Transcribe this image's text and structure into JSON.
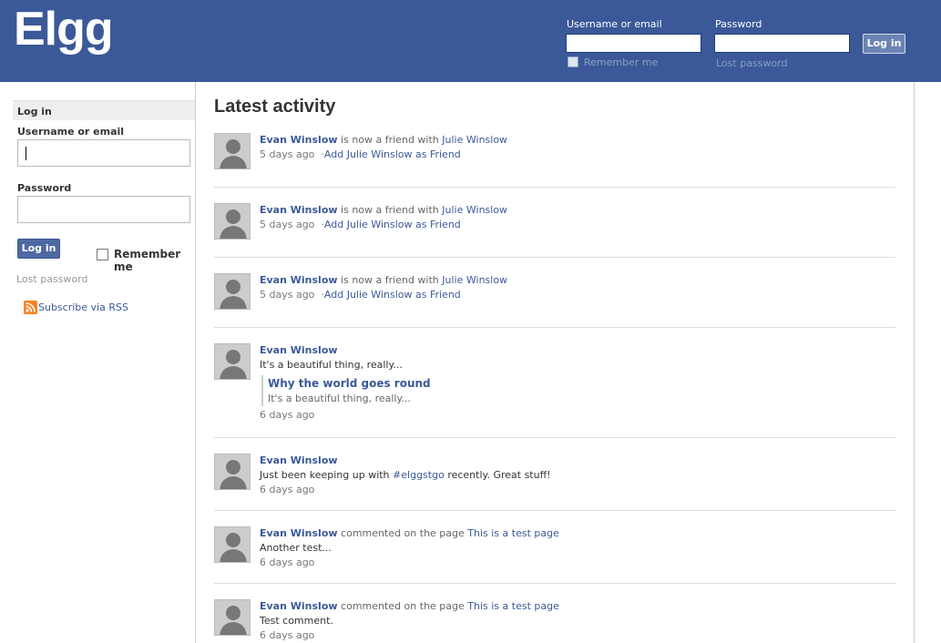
{
  "header": {
    "logo": "Elgg",
    "username_label": "Username or email",
    "password_label": "Password",
    "login_button": "Log in",
    "remember_label": "Remember me",
    "lost_password": "Lost password"
  },
  "sidebar": {
    "title": "Log in",
    "username_label": "Username or email",
    "password_label": "Password",
    "login_button": "Log in",
    "remember_label": "Remember me",
    "lost_password": "Lost password",
    "rss_link": "Subscribe via RSS"
  },
  "main": {
    "title": "Latest activity",
    "items": [
      {
        "user": "Evan Winslow",
        "verb": "is now a friend with",
        "target": "Julie Winslow",
        "time": "5 days ago",
        "action": "Add Julie Winslow as Friend"
      },
      {
        "user": "Evan Winslow",
        "verb": "is now a friend with",
        "target": "Julie Winslow",
        "time": "5 days ago",
        "action": "Add Julie Winslow as Friend"
      },
      {
        "user": "Evan Winslow",
        "verb": "is now a friend with",
        "target": "Julie Winslow",
        "time": "5 days ago",
        "action": "Add Julie Winslow as Friend"
      },
      {
        "user": "Evan Winslow",
        "text": "It's a beautiful thing, really...",
        "attachment_title": "Why the world goes round",
        "attachment_text": "It's a beautiful thing, really...",
        "time": "6 days ago"
      },
      {
        "user": "Evan Winslow",
        "text_before": "Just been keeping up with",
        "hashtag": "#elggstgo",
        "text_after": "recently. Great stuff!",
        "time": "6 days ago"
      },
      {
        "user": "Evan Winslow",
        "verb": "commented on the page",
        "target": "This is a test page",
        "text": "Another test...",
        "time": "6 days ago"
      },
      {
        "user": "Evan Winslow",
        "verb": "commented on the page",
        "target": "This is a test page",
        "text": "Test comment.",
        "time": "6 days ago"
      }
    ]
  }
}
